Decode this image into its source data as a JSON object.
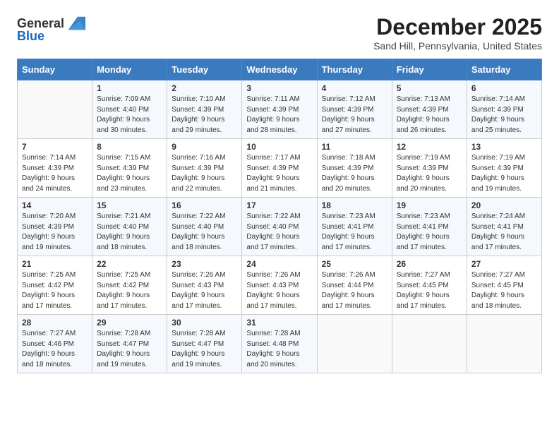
{
  "header": {
    "logo_general": "General",
    "logo_blue": "Blue",
    "month": "December 2025",
    "location": "Sand Hill, Pennsylvania, United States"
  },
  "weekdays": [
    "Sunday",
    "Monday",
    "Tuesday",
    "Wednesday",
    "Thursday",
    "Friday",
    "Saturday"
  ],
  "weeks": [
    [
      {
        "day": "",
        "info": ""
      },
      {
        "day": "1",
        "info": "Sunrise: 7:09 AM\nSunset: 4:40 PM\nDaylight: 9 hours\nand 30 minutes."
      },
      {
        "day": "2",
        "info": "Sunrise: 7:10 AM\nSunset: 4:39 PM\nDaylight: 9 hours\nand 29 minutes."
      },
      {
        "day": "3",
        "info": "Sunrise: 7:11 AM\nSunset: 4:39 PM\nDaylight: 9 hours\nand 28 minutes."
      },
      {
        "day": "4",
        "info": "Sunrise: 7:12 AM\nSunset: 4:39 PM\nDaylight: 9 hours\nand 27 minutes."
      },
      {
        "day": "5",
        "info": "Sunrise: 7:13 AM\nSunset: 4:39 PM\nDaylight: 9 hours\nand 26 minutes."
      },
      {
        "day": "6",
        "info": "Sunrise: 7:14 AM\nSunset: 4:39 PM\nDaylight: 9 hours\nand 25 minutes."
      }
    ],
    [
      {
        "day": "7",
        "info": "Sunrise: 7:14 AM\nSunset: 4:39 PM\nDaylight: 9 hours\nand 24 minutes."
      },
      {
        "day": "8",
        "info": "Sunrise: 7:15 AM\nSunset: 4:39 PM\nDaylight: 9 hours\nand 23 minutes."
      },
      {
        "day": "9",
        "info": "Sunrise: 7:16 AM\nSunset: 4:39 PM\nDaylight: 9 hours\nand 22 minutes."
      },
      {
        "day": "10",
        "info": "Sunrise: 7:17 AM\nSunset: 4:39 PM\nDaylight: 9 hours\nand 21 minutes."
      },
      {
        "day": "11",
        "info": "Sunrise: 7:18 AM\nSunset: 4:39 PM\nDaylight: 9 hours\nand 20 minutes."
      },
      {
        "day": "12",
        "info": "Sunrise: 7:19 AM\nSunset: 4:39 PM\nDaylight: 9 hours\nand 20 minutes."
      },
      {
        "day": "13",
        "info": "Sunrise: 7:19 AM\nSunset: 4:39 PM\nDaylight: 9 hours\nand 19 minutes."
      }
    ],
    [
      {
        "day": "14",
        "info": "Sunrise: 7:20 AM\nSunset: 4:39 PM\nDaylight: 9 hours\nand 19 minutes."
      },
      {
        "day": "15",
        "info": "Sunrise: 7:21 AM\nSunset: 4:40 PM\nDaylight: 9 hours\nand 18 minutes."
      },
      {
        "day": "16",
        "info": "Sunrise: 7:22 AM\nSunset: 4:40 PM\nDaylight: 9 hours\nand 18 minutes."
      },
      {
        "day": "17",
        "info": "Sunrise: 7:22 AM\nSunset: 4:40 PM\nDaylight: 9 hours\nand 17 minutes."
      },
      {
        "day": "18",
        "info": "Sunrise: 7:23 AM\nSunset: 4:41 PM\nDaylight: 9 hours\nand 17 minutes."
      },
      {
        "day": "19",
        "info": "Sunrise: 7:23 AM\nSunset: 4:41 PM\nDaylight: 9 hours\nand 17 minutes."
      },
      {
        "day": "20",
        "info": "Sunrise: 7:24 AM\nSunset: 4:41 PM\nDaylight: 9 hours\nand 17 minutes."
      }
    ],
    [
      {
        "day": "21",
        "info": "Sunrise: 7:25 AM\nSunset: 4:42 PM\nDaylight: 9 hours\nand 17 minutes."
      },
      {
        "day": "22",
        "info": "Sunrise: 7:25 AM\nSunset: 4:42 PM\nDaylight: 9 hours\nand 17 minutes."
      },
      {
        "day": "23",
        "info": "Sunrise: 7:26 AM\nSunset: 4:43 PM\nDaylight: 9 hours\nand 17 minutes."
      },
      {
        "day": "24",
        "info": "Sunrise: 7:26 AM\nSunset: 4:43 PM\nDaylight: 9 hours\nand 17 minutes."
      },
      {
        "day": "25",
        "info": "Sunrise: 7:26 AM\nSunset: 4:44 PM\nDaylight: 9 hours\nand 17 minutes."
      },
      {
        "day": "26",
        "info": "Sunrise: 7:27 AM\nSunset: 4:45 PM\nDaylight: 9 hours\nand 17 minutes."
      },
      {
        "day": "27",
        "info": "Sunrise: 7:27 AM\nSunset: 4:45 PM\nDaylight: 9 hours\nand 18 minutes."
      }
    ],
    [
      {
        "day": "28",
        "info": "Sunrise: 7:27 AM\nSunset: 4:46 PM\nDaylight: 9 hours\nand 18 minutes."
      },
      {
        "day": "29",
        "info": "Sunrise: 7:28 AM\nSunset: 4:47 PM\nDaylight: 9 hours\nand 19 minutes."
      },
      {
        "day": "30",
        "info": "Sunrise: 7:28 AM\nSunset: 4:47 PM\nDaylight: 9 hours\nand 19 minutes."
      },
      {
        "day": "31",
        "info": "Sunrise: 7:28 AM\nSunset: 4:48 PM\nDaylight: 9 hours\nand 20 minutes."
      },
      {
        "day": "",
        "info": ""
      },
      {
        "day": "",
        "info": ""
      },
      {
        "day": "",
        "info": ""
      }
    ]
  ]
}
